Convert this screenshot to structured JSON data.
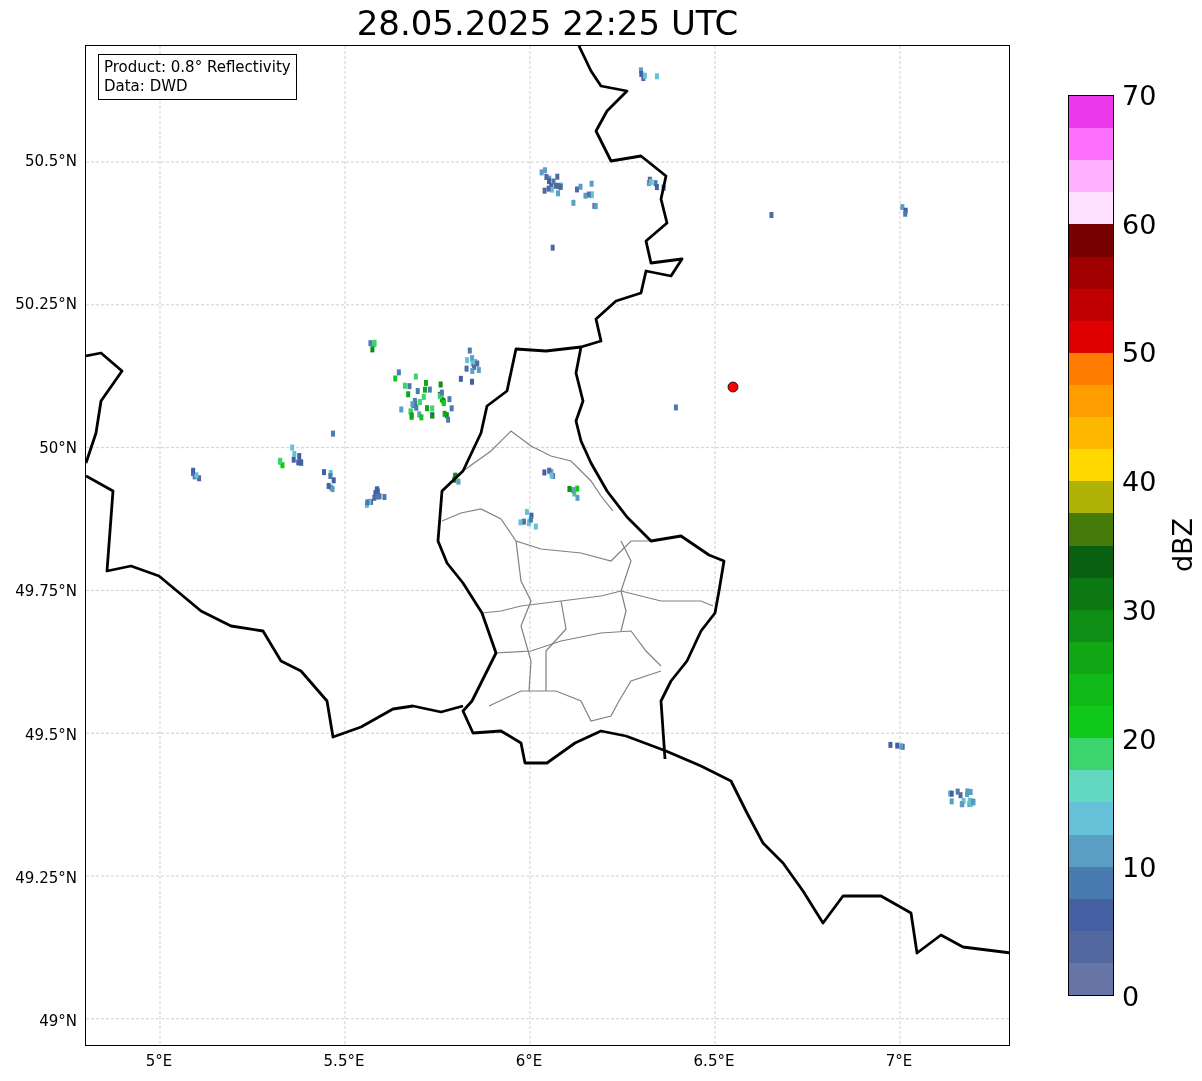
{
  "title": "28.05.2025 22:25 UTC",
  "info_box": {
    "lines": [
      "Product: 0.8° Reflectivity",
      "Data: DWD"
    ]
  },
  "y_ticks": [
    "50.5°N",
    "50.25°N",
    "50°N",
    "49.75°N",
    "49.5°N",
    "49.25°N",
    "49°N"
  ],
  "x_ticks": [
    "5°E",
    "5.5°E",
    "6°E",
    "6.5°E",
    "7°E"
  ],
  "colorbar": {
    "label": "dBZ",
    "ticks": [
      "70",
      "60",
      "50",
      "40",
      "30",
      "20",
      "10",
      "0"
    ],
    "bins": [
      {
        "color": "#ec38ec"
      },
      {
        "color": "#ff70ff"
      },
      {
        "color": "#ffb0ff"
      },
      {
        "color": "#ffe0ff"
      },
      {
        "color": "#780000"
      },
      {
        "color": "#a00000"
      },
      {
        "color": "#c00000"
      },
      {
        "color": "#e00000"
      },
      {
        "color": "#ff7c00"
      },
      {
        "color": "#ff9c00"
      },
      {
        "color": "#ffb800"
      },
      {
        "color": "#ffd800"
      },
      {
        "color": "#b0b208"
      },
      {
        "color": "#467a0a"
      },
      {
        "color": "#086010"
      },
      {
        "color": "#0c7812"
      },
      {
        "color": "#0e8e14"
      },
      {
        "color": "#10a614"
      },
      {
        "color": "#10b818"
      },
      {
        "color": "#10c81a"
      },
      {
        "color": "#3cd46c"
      },
      {
        "color": "#62d8c0"
      },
      {
        "color": "#66c0d8"
      },
      {
        "color": "#5a9ec4"
      },
      {
        "color": "#4a7bb0"
      },
      {
        "color": "#4460a2"
      },
      {
        "color": "#5468a0"
      },
      {
        "color": "#6674a6"
      }
    ]
  }
}
